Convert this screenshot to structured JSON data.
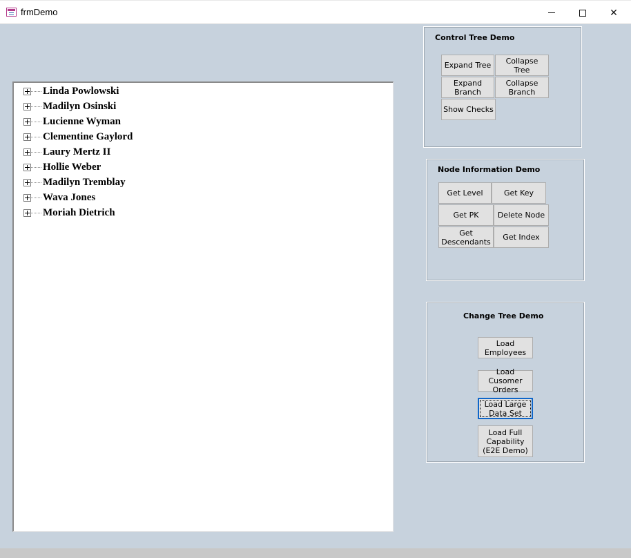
{
  "window": {
    "title": "frmDemo",
    "minimize_icon": "minimize-icon",
    "maximize_icon": "maximize-icon",
    "close_icon": "close-icon"
  },
  "tree": {
    "nodes": [
      {
        "label": "Linda Powlowski"
      },
      {
        "label": "Madilyn Osinski"
      },
      {
        "label": "Lucienne Wyman"
      },
      {
        "label": "Clementine Gaylord"
      },
      {
        "label": "Laury Mertz II"
      },
      {
        "label": "Hollie Weber"
      },
      {
        "label": "Madilyn Tremblay"
      },
      {
        "label": "Wava Jones"
      },
      {
        "label": "Moriah Dietrich"
      }
    ]
  },
  "control_tree": {
    "title": "Control Tree Demo",
    "expand_tree": "Expand Tree",
    "collapse_tree": "Collapse Tree",
    "expand_branch": "Expand Branch",
    "collapse_branch_1": "Collapse",
    "collapse_branch_2": "Branch",
    "show_checks": "Show Checks"
  },
  "node_info": {
    "title": "Node Information Demo",
    "get_level": "Get Level",
    "get_key": "Get Key",
    "get_pk": "Get PK",
    "delete_node": "Delete Node",
    "get_descendants_1": "Get",
    "get_descendants_2": "Descendants",
    "get_index": "Get Index"
  },
  "change_tree": {
    "title": "Change Tree Demo",
    "load_employees_1": "Load",
    "load_employees_2": "Employees",
    "load_customer_orders_1": "Load Cusomer",
    "load_customer_orders_2": "Orders",
    "load_large_1": "Load Large",
    "load_large_2": "Data Set",
    "load_full_1": "Load Full",
    "load_full_2": "Capability",
    "load_full_3": "(E2E Demo)"
  },
  "colors": {
    "form_background": "#c7d2dd",
    "button_face": "#e1e1e1",
    "focus_border": "#0f66c9"
  }
}
